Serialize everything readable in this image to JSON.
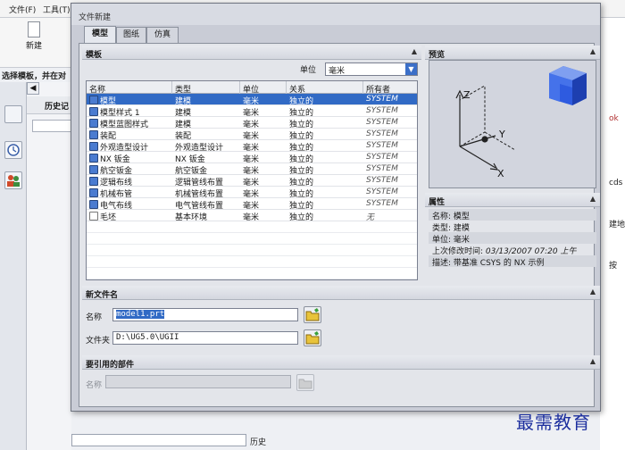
{
  "background_app": {
    "menu": [
      {
        "label": "文件(F)"
      },
      {
        "label": "工具(T)"
      }
    ],
    "toolbar": {
      "new_label": "新建"
    },
    "hint": "选择模板，并在对",
    "history_label": "历史记",
    "bottom_status": "历史",
    "right_fragments": [
      "ok",
      "cds",
      "建地",
      "按"
    ]
  },
  "dialog": {
    "title": "文件新建",
    "tabs": [
      {
        "label": "模型",
        "active": true
      },
      {
        "label": "图纸",
        "active": false
      },
      {
        "label": "仿真",
        "active": false
      }
    ],
    "templates_section": {
      "title": "模板",
      "unit_label": "单位",
      "unit_value": "毫米",
      "columns": [
        "名称",
        "类型",
        "单位",
        "关系",
        "所有者"
      ],
      "rows": [
        {
          "name": "模型",
          "type": "建模",
          "unit": "毫米",
          "relation": "独立的",
          "owner": "SYSTEM",
          "icon": "model-icon",
          "selected": true
        },
        {
          "name": "模型样式 1",
          "type": "建模",
          "unit": "毫米",
          "relation": "独立的",
          "owner": "SYSTEM",
          "icon": "model-style-icon",
          "selected": false
        },
        {
          "name": "模型蓝图样式",
          "type": "建模",
          "unit": "毫米",
          "relation": "独立的",
          "owner": "SYSTEM",
          "icon": "blueprint-style-icon",
          "selected": false
        },
        {
          "name": "装配",
          "type": "装配",
          "unit": "毫米",
          "relation": "独立的",
          "owner": "SYSTEM",
          "icon": "assembly-icon",
          "selected": false
        },
        {
          "name": "外观造型设计",
          "type": "外观造型设计",
          "unit": "毫米",
          "relation": "独立的",
          "owner": "SYSTEM",
          "icon": "shape-studio-icon",
          "selected": false
        },
        {
          "name": "NX 钣金",
          "type": "NX 钣金",
          "unit": "毫米",
          "relation": "独立的",
          "owner": "SYSTEM",
          "icon": "sheet-metal-icon",
          "selected": false
        },
        {
          "name": "航空钣金",
          "type": "航空钣金",
          "unit": "毫米",
          "relation": "独立的",
          "owner": "SYSTEM",
          "icon": "aero-sheet-metal-icon",
          "selected": false
        },
        {
          "name": "逻辑布线",
          "type": "逻辑管线布置",
          "unit": "毫米",
          "relation": "独立的",
          "owner": "SYSTEM",
          "icon": "logical-routing-icon",
          "selected": false
        },
        {
          "name": "机械布管",
          "type": "机械管线布置",
          "unit": "毫米",
          "relation": "独立的",
          "owner": "SYSTEM",
          "icon": "mech-routing-icon",
          "selected": false
        },
        {
          "name": "电气布线",
          "type": "电气管线布置",
          "unit": "毫米",
          "relation": "独立的",
          "owner": "SYSTEM",
          "icon": "elec-routing-icon",
          "selected": false
        },
        {
          "name": "毛坯",
          "type": "基本环境",
          "unit": "毫米",
          "relation": "独立的",
          "owner": "无",
          "icon": "blank-icon",
          "selected": false
        }
      ]
    },
    "preview_section": {
      "title": "预览",
      "axes": [
        "Z",
        "Y",
        "X"
      ]
    },
    "properties_section": {
      "title": "属性",
      "rows": [
        {
          "label": "名称:",
          "value": "模型"
        },
        {
          "label": "类型:",
          "value": "建模"
        },
        {
          "label": "单位:",
          "value": "毫米"
        },
        {
          "label": "上次修改时间:",
          "value": "03/13/2007 07:20 上午"
        },
        {
          "label": "描述:",
          "value": "带基准 CSYS 的 NX 示例"
        }
      ]
    },
    "new_file_section": {
      "title": "新文件名",
      "name_label": "名称",
      "name_value": "model1.prt",
      "folder_label": "文件夹",
      "folder_value": "D:\\UG5.0\\UGII"
    },
    "referenced_section": {
      "title": "要引用的部件",
      "name_label": "名称",
      "name_value": ""
    }
  },
  "watermark": "最需教育",
  "colors": {
    "selection": "#316ac5",
    "dialog_bg": "#e3e5ea",
    "watermark": "#1d2f9e"
  }
}
